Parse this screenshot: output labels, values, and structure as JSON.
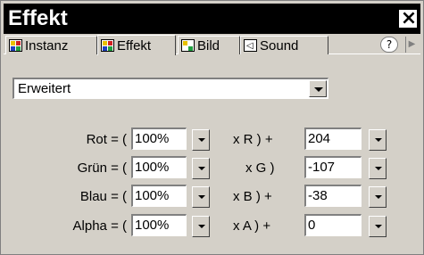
{
  "window": {
    "title": "Effekt",
    "close_label": "×"
  },
  "tabs": [
    {
      "label": "Instanz",
      "icon": "instance-icon",
      "active": false
    },
    {
      "label": "Effekt",
      "icon": "effect-icon",
      "active": true
    },
    {
      "label": "Bild",
      "icon": "frame-icon",
      "active": false
    },
    {
      "label": "Sound",
      "icon": "sound-icon",
      "active": false
    }
  ],
  "help_label": "?",
  "scroll_label": "▶",
  "mode": {
    "selected": "Erweitert"
  },
  "rows": [
    {
      "label": "Rot = (",
      "percent": "100%",
      "channel": "x R ) +",
      "offset": "204"
    },
    {
      "label": "Grün = (",
      "percent": "100%",
      "channel": "x G )",
      "offset": "-107"
    },
    {
      "label": "Blau = (",
      "percent": "100%",
      "channel": "x B ) +",
      "offset": "-38"
    },
    {
      "label": "Alpha = (",
      "percent": "100%",
      "channel": "x A ) +",
      "offset": "0"
    }
  ]
}
